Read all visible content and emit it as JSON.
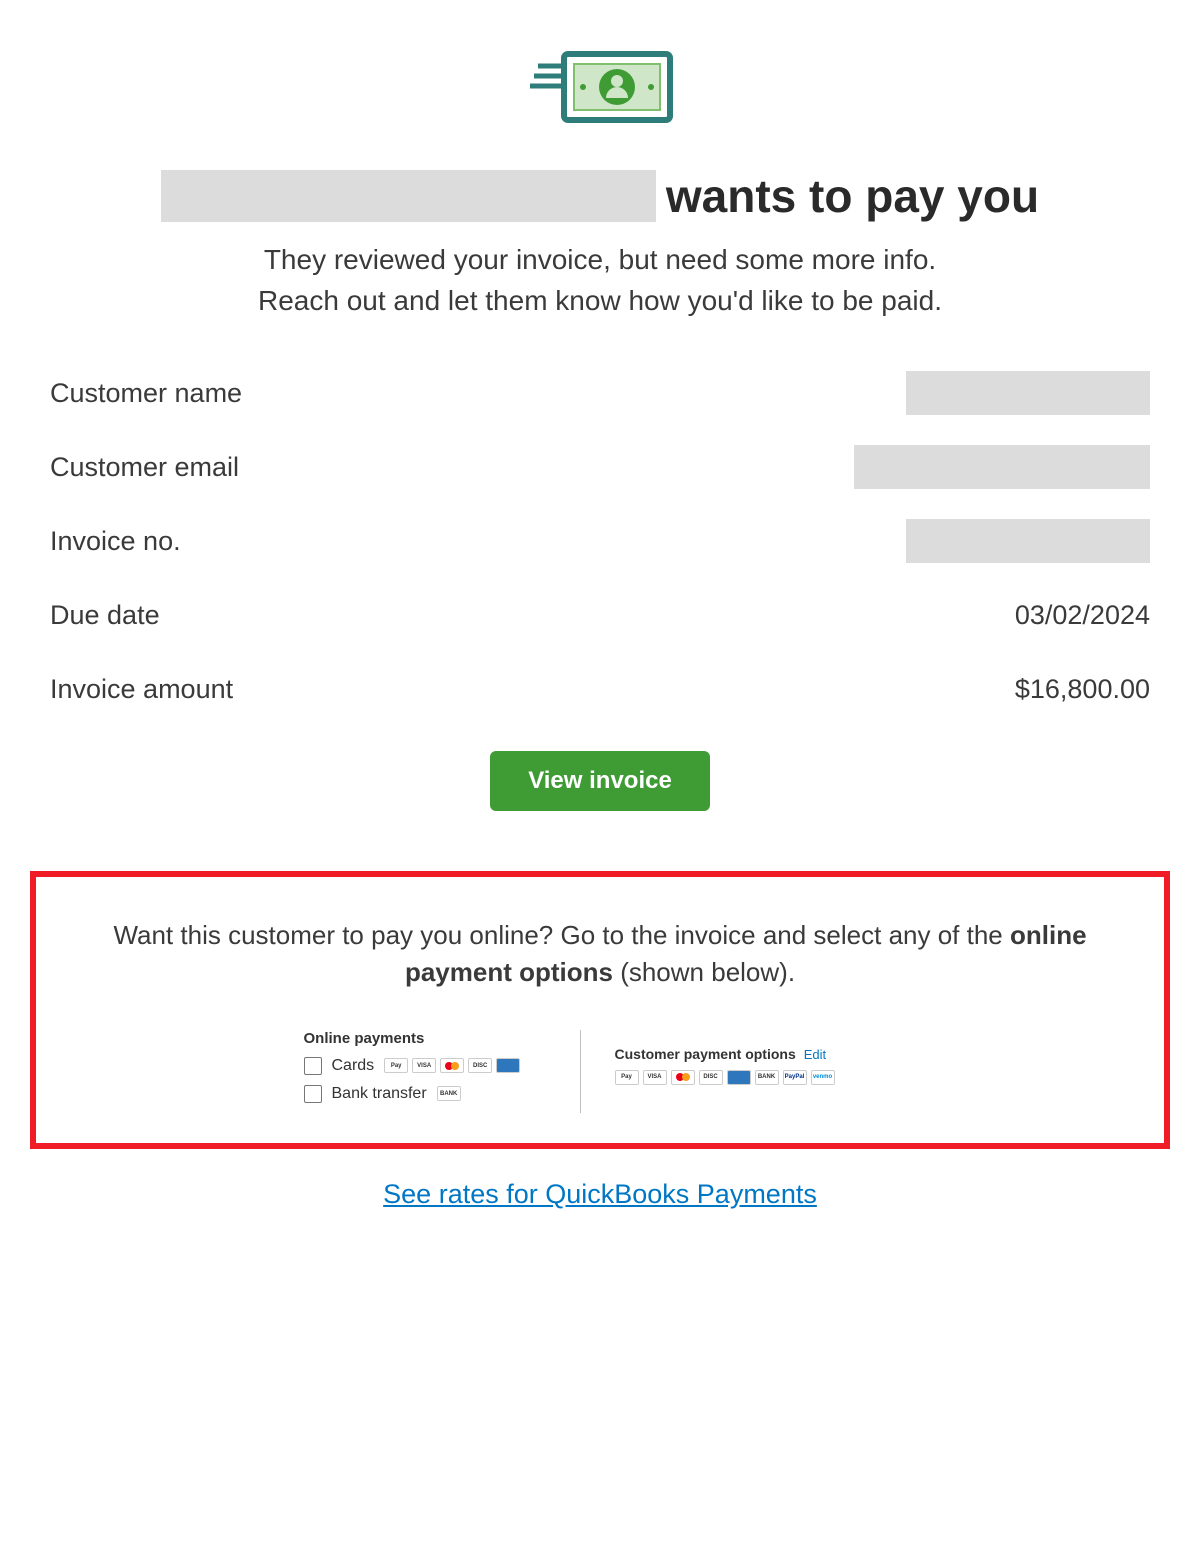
{
  "header": {
    "icon": "payment-logo"
  },
  "headline": {
    "suffix": "wants to pay you"
  },
  "subhead": {
    "line1": "They reviewed your invoice, but need some more info.",
    "line2": "Reach out and let them know how you'd like to be paid."
  },
  "details": {
    "customer_name_label": "Customer name",
    "customer_email_label": "Customer email",
    "invoice_no_label": "Invoice no.",
    "due_date_label": "Due date",
    "due_date_value": "03/02/2024",
    "invoice_amount_label": "Invoice amount",
    "invoice_amount_value": "$16,800.00"
  },
  "cta": {
    "view_invoice": "View invoice"
  },
  "callout": {
    "prefix": "Want this customer to pay you online? Go to the invoice and select any of the ",
    "bold": "online payment options",
    "suffix": " (shown below)."
  },
  "online_payments": {
    "heading": "Online payments",
    "cards_label": "Cards",
    "bank_transfer_label": "Bank transfer",
    "card_badges": [
      "Pay",
      "VISA",
      "",
      "DISC",
      ""
    ],
    "bank_badge": "BANK"
  },
  "customer_payment_options": {
    "heading": "Customer payment options",
    "edit_label": "Edit",
    "badges": [
      "Pay",
      "VISA",
      "",
      "DISC",
      "",
      "BANK",
      "PayPal",
      "venmo"
    ]
  },
  "footer": {
    "rates_link": "See rates for QuickBooks Payments"
  }
}
